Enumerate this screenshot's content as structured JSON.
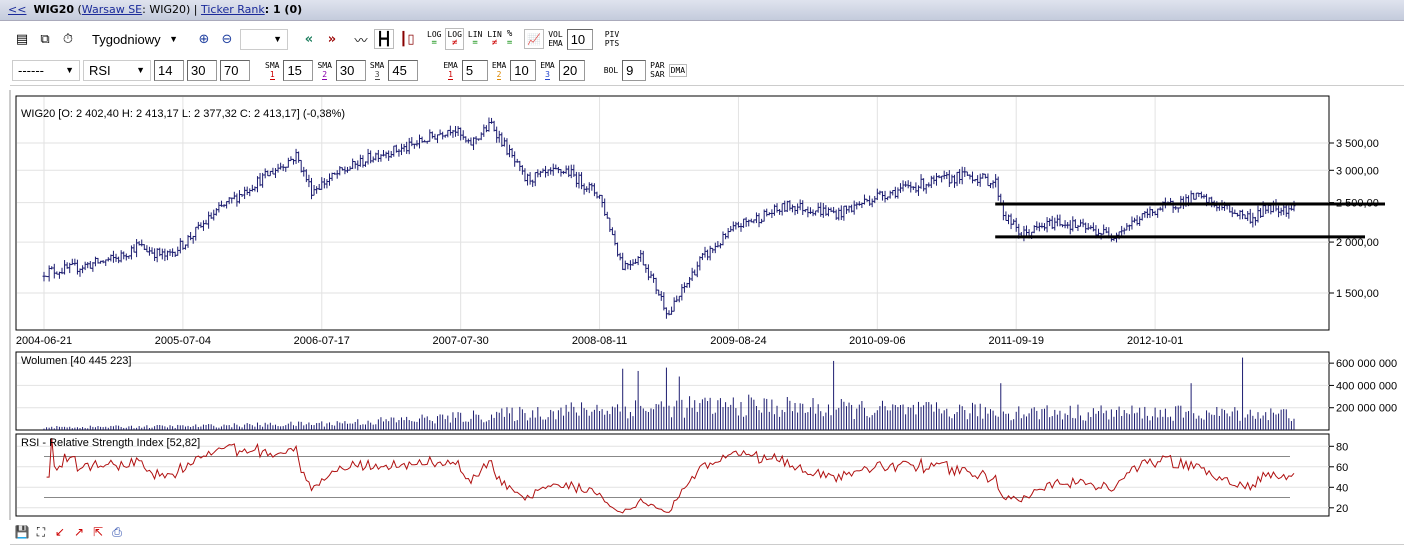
{
  "header": {
    "back": "<<",
    "ticker": "WIG20",
    "exchange_link": "Warsaw SE",
    "symbol": ": WIG20) | ",
    "open_paren": " (",
    "rank_link": "Ticker Rank",
    "rank_value": ": 1 (0)"
  },
  "toolbar1": {
    "interval": "Tygodniowy",
    "zoom_select": "",
    "vol_ema_value": "10",
    "labels": {
      "log_eq": [
        "LOG",
        "="
      ],
      "log_ne": [
        "LOG",
        "≠"
      ],
      "lin_eq": [
        "LIN",
        "="
      ],
      "lin_ne": [
        "LIN",
        "≠"
      ],
      "pct": [
        "%",
        "="
      ],
      "vol_ema": [
        "VOL",
        "EMA"
      ],
      "piv_pts": [
        "PIV",
        "PTS"
      ]
    }
  },
  "toolbar2": {
    "select1": "------",
    "indicator": "RSI",
    "rsi_params": [
      "14",
      "30",
      "70"
    ],
    "sma": [
      {
        "label": "SMA",
        "n": "1",
        "value": "15",
        "color": "#c00000"
      },
      {
        "label": "SMA",
        "n": "2",
        "value": "30",
        "color": "#8000a0"
      },
      {
        "label": "SMA",
        "n": "3",
        "value": "45",
        "color": "#404040"
      }
    ],
    "ema": [
      {
        "label": "EMA",
        "n": "1",
        "value": "5",
        "color": "#c00000"
      },
      {
        "label": "EMA",
        "n": "2",
        "value": "10",
        "color": "#d08000"
      },
      {
        "label": "EMA",
        "n": "3",
        "value": "20",
        "color": "#2040c0"
      }
    ],
    "bol_label": "BOL",
    "bol_value": "9",
    "parsar": [
      "PAR",
      "SAR"
    ],
    "dma": "DMA"
  },
  "chart_data": [
    {
      "type": "ohlc",
      "title": "WIG20 [O: 2 402,40  H: 2 413,17  L: 2 377,32  C: 2 413,17] (-0,38%)",
      "scale": "log",
      "ylim": [
        1250,
        4000
      ],
      "yticks": [
        "3 500,00",
        "3 000,00",
        "2 500,00",
        "2 000,00",
        "1 500,00"
      ],
      "ytick_values": [
        3500,
        3000,
        2500,
        2000,
        1500
      ],
      "xticks": [
        "2004-06-21",
        "2005-07-04",
        "2006-07-17",
        "2007-07-30",
        "2008-08-11",
        "2009-08-24",
        "2010-09-06",
        "2011-09-19",
        "2012-10-01"
      ],
      "start": "2004-06-21",
      "end": "2013-10-14",
      "color": "#1c1c70",
      "grid": true,
      "close_keypoints": [
        [
          "2004-06-21",
          1690
        ],
        [
          "2004-09-01",
          1720
        ],
        [
          "2005-01-10",
          1830
        ],
        [
          "2005-03-01",
          1960
        ],
        [
          "2005-05-20",
          1840
        ],
        [
          "2005-07-04",
          1980
        ],
        [
          "2005-10-10",
          2400
        ],
        [
          "2006-01-09",
          2760
        ],
        [
          "2006-05-08",
          3260
        ],
        [
          "2006-06-19",
          2680
        ],
        [
          "2006-09-01",
          2950
        ],
        [
          "2006-12-18",
          3300
        ],
        [
          "2007-03-05",
          3400
        ],
        [
          "2007-07-09",
          3830
        ],
        [
          "2007-08-20",
          3450
        ],
        [
          "2007-10-22",
          3900
        ],
        [
          "2008-01-21",
          2850
        ],
        [
          "2008-05-12",
          3000
        ],
        [
          "2008-08-11",
          2600
        ],
        [
          "2008-10-13",
          1750
        ],
        [
          "2008-12-01",
          1850
        ],
        [
          "2009-02-16",
          1330
        ],
        [
          "2009-05-11",
          1800
        ],
        [
          "2009-08-24",
          2200
        ],
        [
          "2010-01-11",
          2460
        ],
        [
          "2010-05-24",
          2350
        ],
        [
          "2010-09-06",
          2600
        ],
        [
          "2011-01-10",
          2780
        ],
        [
          "2011-05-09",
          2920
        ],
        [
          "2011-07-25",
          2800
        ],
        [
          "2011-08-15",
          2350
        ],
        [
          "2011-10-03",
          2080
        ],
        [
          "2012-01-09",
          2250
        ],
        [
          "2012-06-04",
          2080
        ],
        [
          "2012-10-01",
          2400
        ],
        [
          "2013-01-21",
          2580
        ],
        [
          "2013-06-24",
          2280
        ],
        [
          "2013-08-05",
          2450
        ],
        [
          "2013-10-14",
          2413
        ]
      ],
      "annotations": [
        {
          "type": "hline",
          "value": 2480,
          "from": "2011-08-01"
        },
        {
          "type": "hline",
          "value": 2060,
          "from": "2011-08-01"
        }
      ]
    },
    {
      "type": "bar",
      "title": "Wolumen [40 445 223]",
      "ylim": [
        0,
        700000000
      ],
      "yticks": [
        "600 000 000",
        "400 000 000",
        "200 000 000"
      ],
      "ytick_values": [
        600000000,
        400000000,
        200000000
      ],
      "color": "#1c1c70",
      "volume_keypoints_millions": [
        [
          "2004-06-21",
          25
        ],
        [
          "2005-07-04",
          35
        ],
        [
          "2006-07-17",
          60
        ],
        [
          "2007-07-30",
          120
        ],
        [
          "2008-08-11",
          200
        ],
        [
          "2009-08-24",
          230
        ],
        [
          "2010-09-06",
          190
        ],
        [
          "2011-09-19",
          170
        ],
        [
          "2012-10-01",
          160
        ],
        [
          "2013-10-14",
          150
        ]
      ],
      "spikes_millions": [
        [
          "2008-10-13",
          550
        ],
        [
          "2008-11-24",
          530
        ],
        [
          "2009-02-09",
          560
        ],
        [
          "2009-03-16",
          480
        ],
        [
          "2010-05-10",
          620
        ],
        [
          "2011-08-08",
          420
        ],
        [
          "2013-05-27",
          650
        ],
        [
          "2013-01-07",
          420
        ]
      ]
    },
    {
      "type": "line",
      "title": "RSI - Relative Strength Index [52,82]",
      "ylim": [
        12,
        92
      ],
      "yticks": [
        "80",
        "60",
        "40",
        "20"
      ],
      "ytick_values": [
        80,
        60,
        40,
        20
      ],
      "levels": [
        30,
        70
      ],
      "period": 14,
      "color": "#b01010"
    }
  ],
  "bottom": {
    "icons": [
      "save-icon",
      "fit-icon",
      "import-icon",
      "export-icon",
      "expand-icon",
      "print-icon"
    ]
  }
}
